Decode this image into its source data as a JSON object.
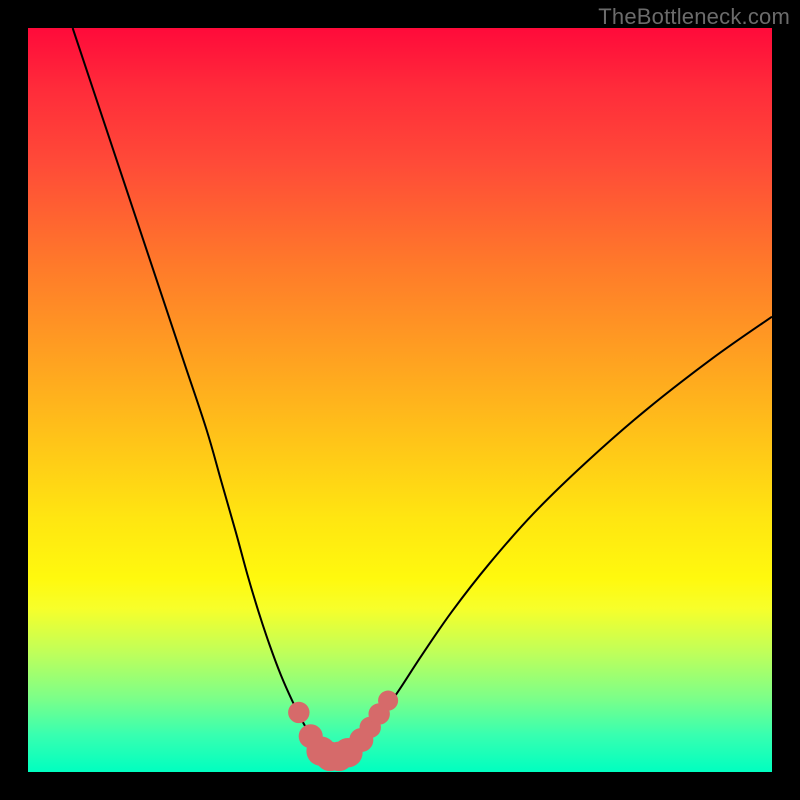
{
  "watermark": "TheBottleneck.com",
  "colors": {
    "background": "#000000",
    "curve": "#000000",
    "marker_fill": "#d66a6a",
    "marker_stroke": "#c75a5a"
  },
  "chart_data": {
    "type": "line",
    "title": "",
    "xlabel": "",
    "ylabel": "",
    "xlim": [
      0,
      100
    ],
    "ylim": [
      0,
      100
    ],
    "grid": false,
    "series": [
      {
        "name": "left-curve",
        "x": [
          6,
          10,
          14,
          18,
          21,
          24,
          26,
          28,
          29.5,
          31,
          32.5,
          34,
          35.5,
          37,
          38.4,
          39.5
        ],
        "values": [
          100,
          88,
          76,
          64,
          55,
          46,
          39,
          32,
          26.5,
          21.5,
          17,
          13,
          9.6,
          6.6,
          4.3,
          3.0
        ]
      },
      {
        "name": "right-curve",
        "x": [
          43.5,
          45,
          46.5,
          48,
          50,
          53,
          57,
          62,
          68,
          75,
          83,
          92,
          100
        ],
        "values": [
          3.0,
          4.4,
          6.2,
          8.3,
          11.2,
          15.8,
          21.6,
          28,
          34.8,
          41.6,
          48.6,
          55.6,
          61.2
        ]
      },
      {
        "name": "flat-segment",
        "x": [
          39.5,
          40.5,
          41.5,
          42.5,
          43.5
        ],
        "values": [
          3.0,
          2.2,
          2.0,
          2.2,
          3.0
        ]
      }
    ],
    "markers": [
      {
        "x": 36.4,
        "y": 8.0,
        "r": 1.0
      },
      {
        "x": 38.0,
        "y": 4.8,
        "r": 1.2
      },
      {
        "x": 39.4,
        "y": 2.8,
        "r": 1.6
      },
      {
        "x": 40.6,
        "y": 2.1,
        "r": 1.6
      },
      {
        "x": 41.8,
        "y": 2.1,
        "r": 1.6
      },
      {
        "x": 43.0,
        "y": 2.6,
        "r": 1.6
      },
      {
        "x": 44.8,
        "y": 4.3,
        "r": 1.2
      },
      {
        "x": 46.0,
        "y": 6.0,
        "r": 1.0
      },
      {
        "x": 47.2,
        "y": 7.8,
        "r": 1.0
      },
      {
        "x": 48.4,
        "y": 9.6,
        "r": 0.9
      }
    ]
  }
}
